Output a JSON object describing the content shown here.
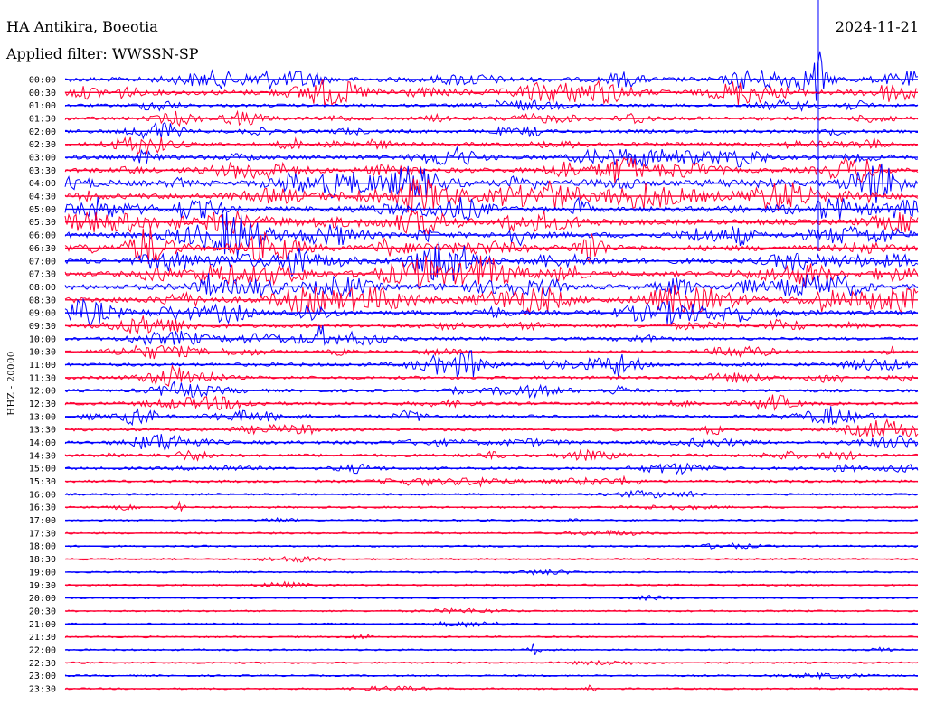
{
  "header": {
    "station": "HA Antikira, Boeotia",
    "filter": "Applied filter: WWSSN-SP",
    "date": "2024-11-21"
  },
  "chart_data": {
    "type": "line",
    "ylabel": "HHZ - 20000",
    "colors": [
      "#0000ff",
      "#ff0033"
    ],
    "x_range_minutes": [
      0,
      30
    ],
    "hours": [
      "00:00",
      "00:30",
      "01:00",
      "01:30",
      "02:00",
      "02:30",
      "03:00",
      "03:30",
      "04:00",
      "04:30",
      "05:00",
      "05:30",
      "06:00",
      "06:30",
      "07:00",
      "07:30",
      "08:00",
      "08:30",
      "09:00",
      "09:30",
      "10:00",
      "10:30",
      "11:00",
      "11:30",
      "12:00",
      "12:30",
      "13:00",
      "13:30",
      "14:00",
      "14:30",
      "15:00",
      "15:30",
      "16:00",
      "16:30",
      "17:00",
      "17:30",
      "18:00",
      "18:30",
      "19:00",
      "19:30",
      "20:00",
      "20:30",
      "21:00",
      "21:30",
      "22:00",
      "22:30",
      "23:00",
      "23:30"
    ],
    "trace_activity": [
      0.8,
      0.9,
      0.4,
      0.5,
      0.5,
      0.6,
      0.7,
      0.8,
      1.0,
      1.0,
      0.9,
      1.0,
      1.0,
      1.0,
      0.9,
      0.9,
      0.9,
      1.0,
      0.8,
      0.6,
      0.4,
      0.4,
      0.5,
      0.4,
      0.4,
      0.4,
      0.5,
      0.4,
      0.5,
      0.4,
      0.35,
      0.3,
      0.15,
      0.15,
      0.12,
      0.1,
      0.1,
      0.1,
      0.08,
      0.08,
      0.08,
      0.08,
      0.08,
      0.08,
      0.08,
      0.08,
      0.08,
      0.08
    ],
    "events": [
      {
        "time": "10:00",
        "minute": 9,
        "amp": 1.0
      },
      {
        "time": "10:30",
        "minute": 29,
        "amp": 1.0
      },
      {
        "time": "11:00",
        "minute": 19.5,
        "amp": 1.5
      },
      {
        "time": "16:30",
        "minute": 4,
        "amp": 0.6
      },
      {
        "time": "22:00",
        "minute": 16.5,
        "amp": 0.8
      },
      {
        "time": "23:30",
        "minute": 18.5,
        "amp": 0.6
      },
      {
        "time": "00:00",
        "minute": 26.5,
        "amp": 3.0
      }
    ]
  }
}
